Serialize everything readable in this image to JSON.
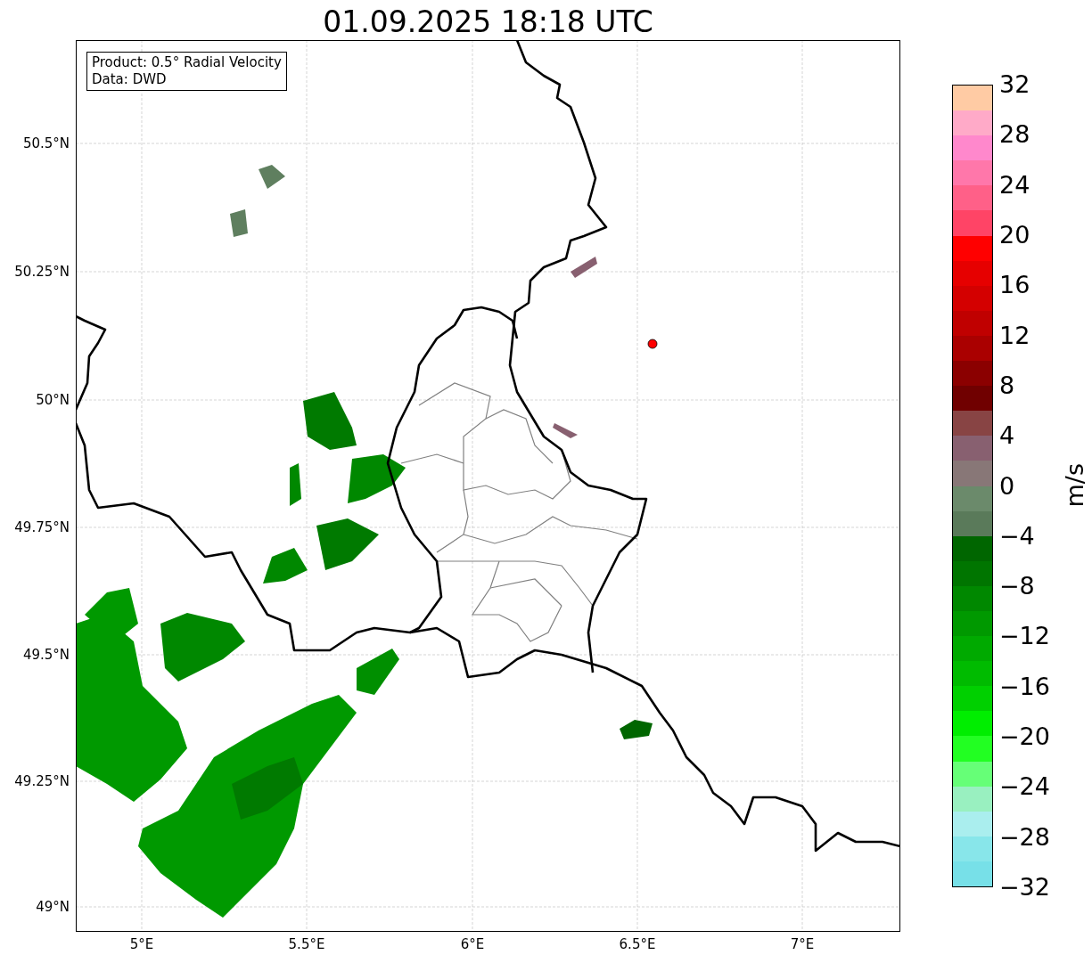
{
  "title": "01.09.2025 18:18 UTC",
  "info_box": [
    "Product: 0.5° Radial Velocity",
    "Data: DWD"
  ],
  "map": {
    "lat_labels": [
      "50.5°N",
      "50.25°N",
      "50°N",
      "49.75°N",
      "49.5°N",
      "49.25°N",
      "49°N"
    ],
    "lon_labels": [
      "5°E",
      "5.5°E",
      "6°E",
      "6.5°E",
      "7°E"
    ]
  },
  "colorbar": {
    "label": "m/s",
    "ticks": [
      "32",
      "28",
      "24",
      "20",
      "16",
      "12",
      "8",
      "4",
      "0",
      "−4",
      "−8",
      "−12",
      "−16",
      "−20",
      "−24",
      "−28",
      "−32"
    ],
    "segments": [
      {
        "color": "#ffcba4"
      },
      {
        "color": "#ffaac8"
      },
      {
        "color": "#ff88cc"
      },
      {
        "color": "#ff77aa"
      },
      {
        "color": "#ff6088"
      },
      {
        "color": "#ff4466"
      },
      {
        "color": "#ff0000"
      },
      {
        "color": "#e60000"
      },
      {
        "color": "#d40000"
      },
      {
        "color": "#c00000"
      },
      {
        "color": "#aa0000"
      },
      {
        "color": "#8b0000"
      },
      {
        "color": "#700000"
      },
      {
        "color": "#884444"
      },
      {
        "color": "#886070"
      },
      {
        "color": "#887777"
      },
      {
        "color": "#6b8a6b"
      },
      {
        "color": "#5a7a5a"
      },
      {
        "color": "#006600"
      },
      {
        "color": "#007500"
      },
      {
        "color": "#008800"
      },
      {
        "color": "#009900"
      },
      {
        "color": "#00aa00"
      },
      {
        "color": "#00bb00"
      },
      {
        "color": "#00d000"
      },
      {
        "color": "#00ee00"
      },
      {
        "color": "#22ff22"
      },
      {
        "color": "#66ff77"
      },
      {
        "color": "#99f0c0"
      },
      {
        "color": "#aaeeee"
      },
      {
        "color": "#88e6ea"
      },
      {
        "color": "#77e0e8"
      }
    ]
  }
}
